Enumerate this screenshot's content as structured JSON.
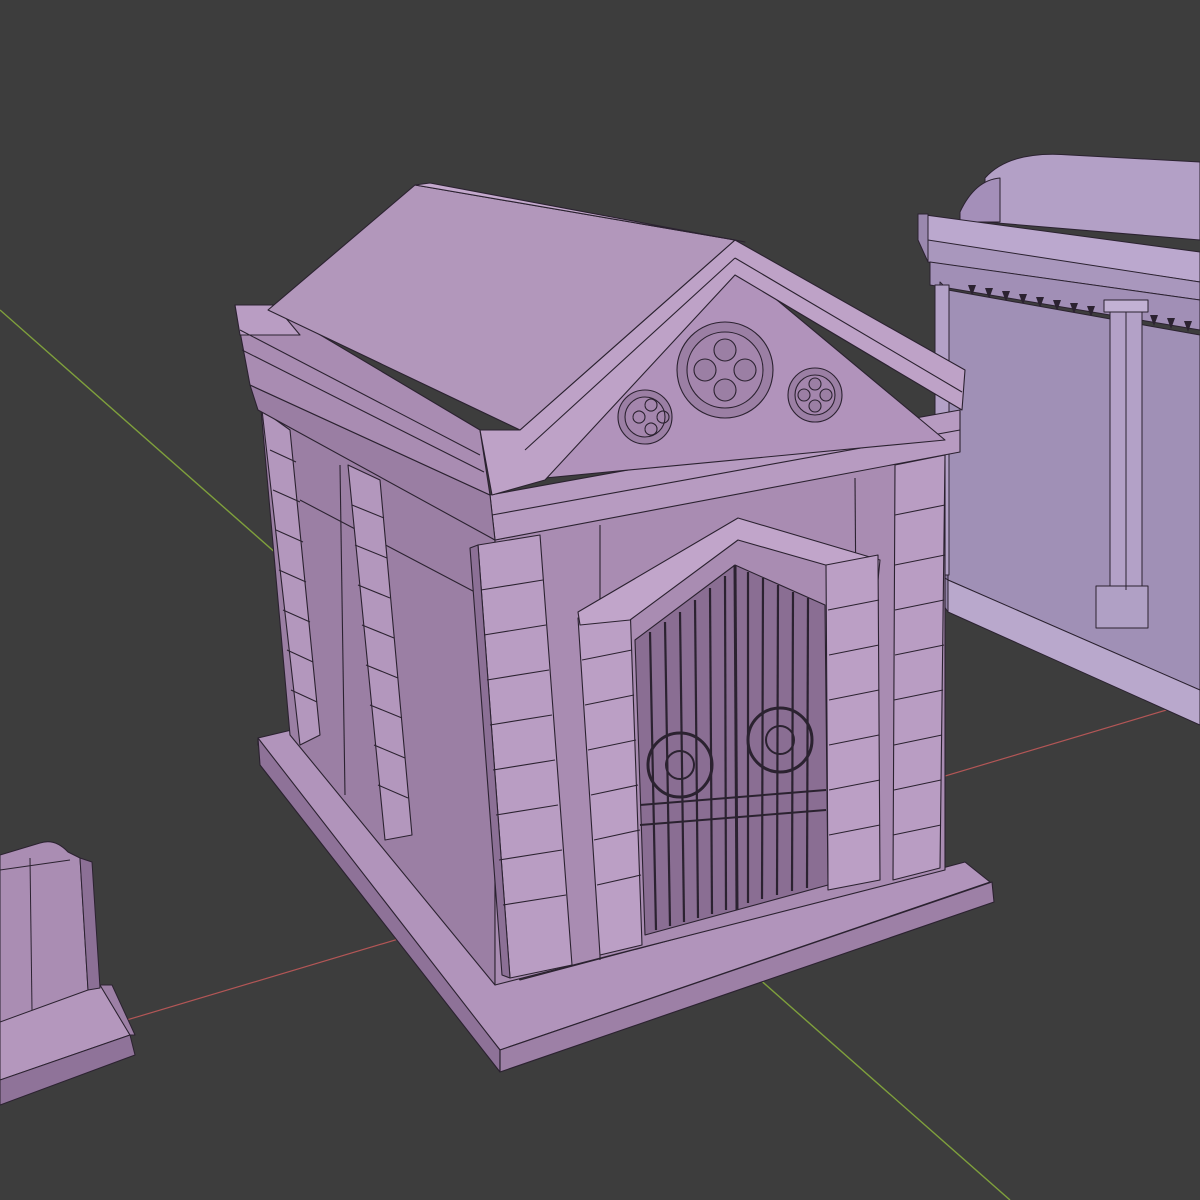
{
  "viewport": {
    "background": "#3d3d3d",
    "x_axis_color": "#b35656",
    "y_axis_color": "#7fa03c"
  },
  "materials": {
    "stone_light": "#b89ac0",
    "stone_mid": "#a486ad",
    "stone_dark": "#8a6e93",
    "stone_shadow": "#6f5677",
    "wire": "#2b2230",
    "far_light": "#b5a3c9",
    "far_dark": "#9886ad"
  },
  "objects": [
    {
      "name": "mausoleum-gabled",
      "selected": false
    },
    {
      "name": "mausoleum-vaulted",
      "selected": false
    },
    {
      "name": "headstone",
      "selected": false
    }
  ]
}
